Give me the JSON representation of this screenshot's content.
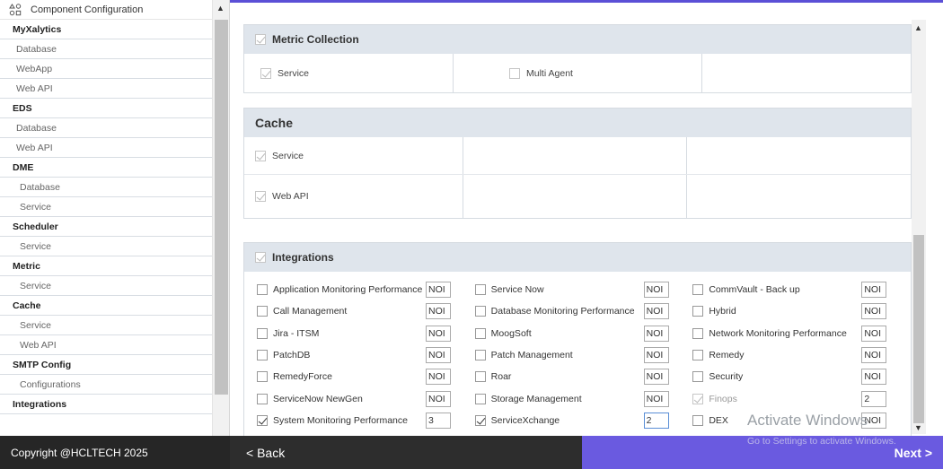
{
  "sidebar": {
    "header": "Component Configuration",
    "rows": [
      {
        "label": "MyXalytics",
        "kind": "group"
      },
      {
        "label": "Database",
        "kind": "item"
      },
      {
        "label": "WebApp",
        "kind": "item"
      },
      {
        "label": "Web API",
        "kind": "item"
      },
      {
        "label": "EDS",
        "kind": "group"
      },
      {
        "label": "Database",
        "kind": "item"
      },
      {
        "label": "Web API",
        "kind": "item"
      },
      {
        "label": "DME",
        "kind": "group"
      },
      {
        "label": "Database",
        "kind": "deep"
      },
      {
        "label": "Service",
        "kind": "deep"
      },
      {
        "label": "Scheduler",
        "kind": "group"
      },
      {
        "label": "Service",
        "kind": "deep"
      },
      {
        "label": "Metric",
        "kind": "group"
      },
      {
        "label": "Service",
        "kind": "deep"
      },
      {
        "label": "Cache",
        "kind": "group"
      },
      {
        "label": "Service",
        "kind": "deep"
      },
      {
        "label": "Web API",
        "kind": "deep"
      },
      {
        "label": "SMTP Config",
        "kind": "group"
      },
      {
        "label": "Configurations",
        "kind": "deep"
      },
      {
        "label": "Integrations",
        "kind": "group"
      }
    ]
  },
  "metric_collection": {
    "title": "Metric Collection",
    "service": "Service",
    "multi_agent": "Multi Agent"
  },
  "cache": {
    "title": "Cache",
    "service": "Service",
    "web_api": "Web API"
  },
  "integrations": {
    "title": "Integrations",
    "rows": [
      [
        {
          "label": "Application Monitoring  Performance",
          "value": "NOI",
          "checked": false
        },
        {
          "label": "Service Now",
          "value": "NOI",
          "checked": false
        },
        {
          "label": "CommVault - Back up",
          "value": "NOI",
          "checked": false
        }
      ],
      [
        {
          "label": "Call Management",
          "value": "NOI",
          "checked": false
        },
        {
          "label": "Database Monitoring  Performance",
          "value": "NOI",
          "checked": false
        },
        {
          "label": "Hybrid",
          "value": "NOI",
          "checked": false
        }
      ],
      [
        {
          "label": "Jira - ITSM",
          "value": "NOI",
          "checked": false
        },
        {
          "label": "MoogSoft",
          "value": "NOI",
          "checked": false
        },
        {
          "label": "Network Monitoring  Performance",
          "value": "NOI",
          "checked": false
        }
      ],
      [
        {
          "label": "PatchDB",
          "value": "NOI",
          "checked": false
        },
        {
          "label": "Patch Management",
          "value": "NOI",
          "checked": false
        },
        {
          "label": "Remedy",
          "value": "NOI",
          "checked": false
        }
      ],
      [
        {
          "label": "RemedyForce",
          "value": "NOI",
          "checked": false
        },
        {
          "label": "Roar",
          "value": "NOI",
          "checked": false
        },
        {
          "label": "Security",
          "value": "NOI",
          "checked": false
        }
      ],
      [
        {
          "label": "ServiceNow NewGen",
          "value": "NOI",
          "checked": false
        },
        {
          "label": "Storage Management",
          "value": "NOI",
          "checked": false
        },
        {
          "label": "Finops",
          "value": "2",
          "checked": true,
          "muted": true
        }
      ],
      [
        {
          "label": "System Monitoring  Performance",
          "value": "3",
          "checked": true
        },
        {
          "label": "ServiceXchange",
          "value": "2",
          "checked": true,
          "active": true
        },
        {
          "label": "DEX",
          "value": "NOI",
          "checked": false
        }
      ]
    ]
  },
  "watermark": {
    "line1": "Activate Windows",
    "line2": "Go to Settings to activate Windows."
  },
  "footer": {
    "copyright": "Copyright @HCLTECH 2025",
    "back": "< Back",
    "next": "Next >"
  },
  "colors": {
    "accent": "#6a5ae0",
    "section_header": "#dfe5ec",
    "footer_dark": "#262626"
  }
}
